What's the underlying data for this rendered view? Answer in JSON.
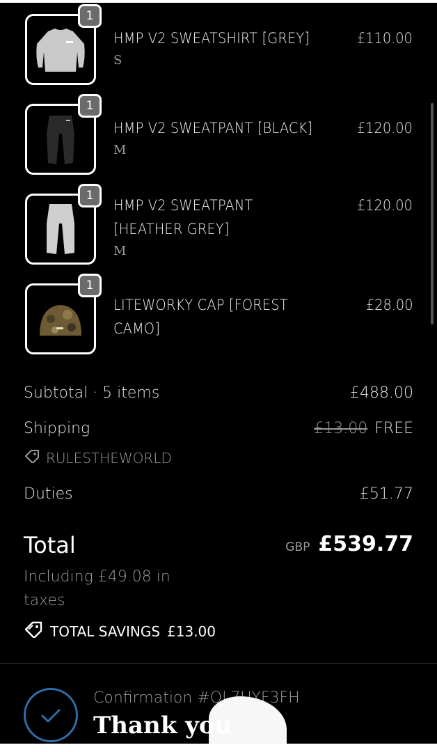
{
  "cart": {
    "items": [
      {
        "name": "HMP V2 SWEATSHIRT [GREY]",
        "variant": "S",
        "price": "£110.00",
        "quantity": "1",
        "image": "sweatshirt-grey"
      },
      {
        "name": "HMP V2 SWEATPANT [BLACK]",
        "variant": "M",
        "price": "£120.00",
        "quantity": "1",
        "image": "sweatpant-black"
      },
      {
        "name": "HMP V2 SWEATPANT [HEATHER GREY]",
        "variant": "M",
        "price": "£120.00",
        "quantity": "1",
        "image": "sweatpant-heather-grey"
      },
      {
        "name": "LITEWORKY CAP [FOREST CAMO]",
        "variant": "",
        "price": "£28.00",
        "quantity": "1",
        "image": "cap-forest-camo"
      }
    ]
  },
  "summary": {
    "subtotal_label": "Subtotal · 5 items",
    "subtotal_value": "£488.00",
    "shipping_label": "Shipping",
    "shipping_original": "£13.00",
    "shipping_value": "FREE",
    "discount_code": "RULESTHEWORLD",
    "duties_label": "Duties",
    "duties_value": "£51.77",
    "total_label": "Total",
    "currency": "GBP",
    "total_value": "£539.77",
    "tax_note": "Including £49.08 in taxes",
    "savings_label": "TOTAL SAVINGS",
    "savings_value": "£13.00"
  },
  "confirmation": {
    "number": "Confirmation #QL7UYF3FH",
    "title": "Thank you"
  },
  "colors": {
    "background": "#000000",
    "text": "#e8e8e8",
    "muted": "#9a9a9a",
    "accent": "#2f6ea8",
    "badge": "#6b6b6b"
  },
  "icons": [
    "tag-icon",
    "savings-tag-icon",
    "check-icon"
  ]
}
